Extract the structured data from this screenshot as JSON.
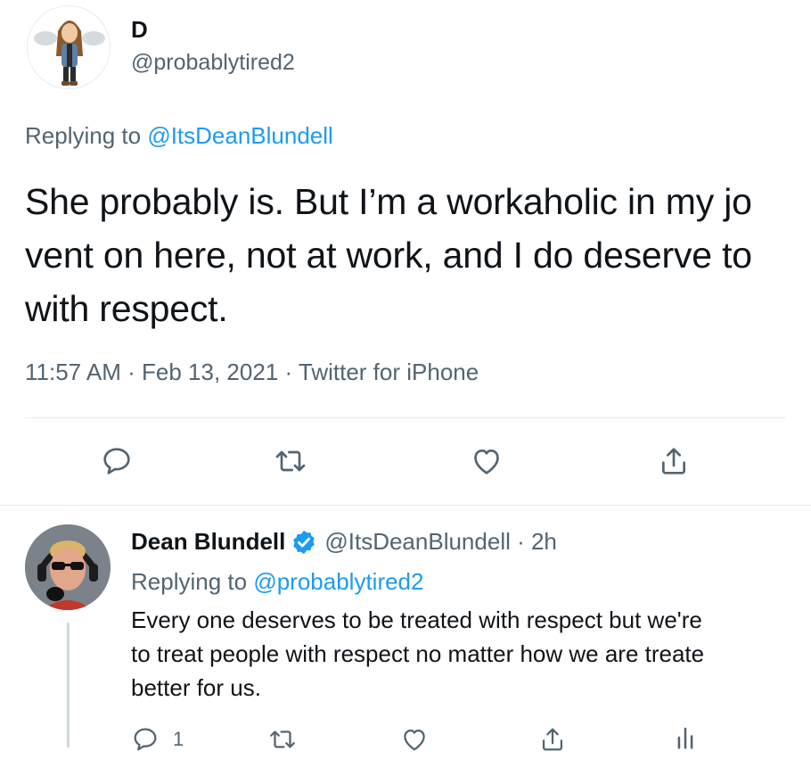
{
  "main_tweet": {
    "display_name": "D",
    "handle": "@probablytired2",
    "replying_prefix": "Replying to",
    "replying_to": "@ItsDeanBlundell",
    "text_lines": [
      "She probably is. But I’m a workaholic in my jo",
      "vent on here, not at work, and I do deserve to",
      "with respect."
    ],
    "meta": "11:57 AM · Feb 13, 2021 · Twitter for iPhone",
    "actions": [
      "reply-icon",
      "retweet-icon",
      "like-icon",
      "share-icon"
    ]
  },
  "reply_tweet": {
    "display_name": "Dean Blundell",
    "handle_time": "@ItsDeanBlundell · 2h",
    "replying_prefix": "Replying to",
    "replying_to": "@probablytired2",
    "text_lines": [
      "Every one deserves to be treated with respect but we're",
      "to treat people with respect no matter how we are treate",
      "better for us."
    ],
    "reply_count": "1",
    "actions": [
      "reply-icon",
      "retweet-icon",
      "like-icon",
      "share-icon",
      "analytics-icon"
    ]
  },
  "colors": {
    "link": "#1d9bf0",
    "secondary": "#536471",
    "verified": "#1d9bf0",
    "divider": "#e6ecf0"
  }
}
